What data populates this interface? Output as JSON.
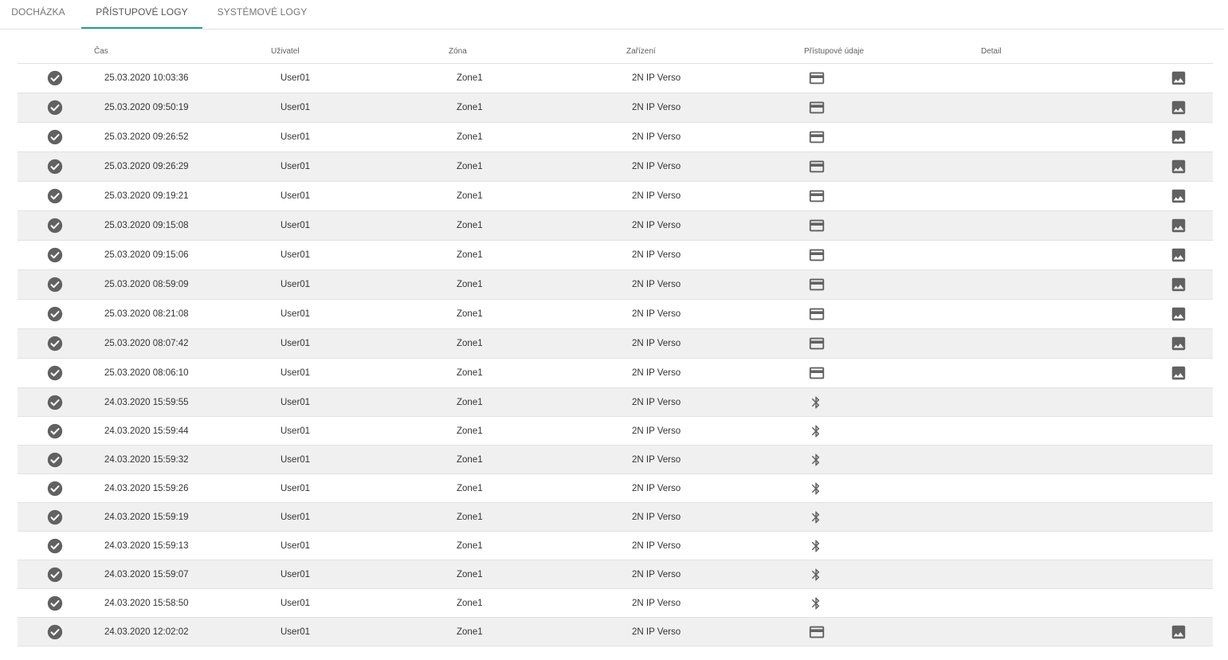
{
  "tabs": [
    {
      "label": "DOCHÁZKA"
    },
    {
      "label": "PŘÍSTUPOVÉ LOGY"
    },
    {
      "label": "SYSTÉMOVÉ LOGY"
    }
  ],
  "active_tab": "PŘÍSTUPOVÉ LOGY",
  "accent_color": "#27a18d",
  "table": {
    "headers": {
      "time": "Čas",
      "user": "Uživatel",
      "zone": "Zóna",
      "device": "Zařízení",
      "credentials": "Přístupové údaje",
      "detail": "Detail"
    },
    "rows": [
      {
        "time": "25.03.2020 10:03:36",
        "user": "User01",
        "zone": "Zone1",
        "device": "2N IP Verso",
        "credential_icon": "card-icon",
        "has_photo": true
      },
      {
        "time": "25.03.2020 09:50:19",
        "user": "User01",
        "zone": "Zone1",
        "device": "2N IP Verso",
        "credential_icon": "card-icon",
        "has_photo": true
      },
      {
        "time": "25.03.2020 09:26:52",
        "user": "User01",
        "zone": "Zone1",
        "device": "2N IP Verso",
        "credential_icon": "card-icon",
        "has_photo": true
      },
      {
        "time": "25.03.2020 09:26:29",
        "user": "User01",
        "zone": "Zone1",
        "device": "2N IP Verso",
        "credential_icon": "card-icon",
        "has_photo": true
      },
      {
        "time": "25.03.2020 09:19:21",
        "user": "User01",
        "zone": "Zone1",
        "device": "2N IP Verso",
        "credential_icon": "card-icon",
        "has_photo": true
      },
      {
        "time": "25.03.2020 09:15:08",
        "user": "User01",
        "zone": "Zone1",
        "device": "2N IP Verso",
        "credential_icon": "card-icon",
        "has_photo": true
      },
      {
        "time": "25.03.2020 09:15:06",
        "user": "User01",
        "zone": "Zone1",
        "device": "2N IP Verso",
        "credential_icon": "card-icon",
        "has_photo": true
      },
      {
        "time": "25.03.2020 08:59:09",
        "user": "User01",
        "zone": "Zone1",
        "device": "2N IP Verso",
        "credential_icon": "card-icon",
        "has_photo": true
      },
      {
        "time": "25.03.2020 08:21:08",
        "user": "User01",
        "zone": "Zone1",
        "device": "2N IP Verso",
        "credential_icon": "card-icon",
        "has_photo": true
      },
      {
        "time": "25.03.2020 08:07:42",
        "user": "User01",
        "zone": "Zone1",
        "device": "2N IP Verso",
        "credential_icon": "card-icon",
        "has_photo": true
      },
      {
        "time": "25.03.2020 08:06:10",
        "user": "User01",
        "zone": "Zone1",
        "device": "2N IP Verso",
        "credential_icon": "card-icon",
        "has_photo": true
      },
      {
        "time": "24.03.2020 15:59:55",
        "user": "User01",
        "zone": "Zone1",
        "device": "2N IP Verso",
        "credential_icon": "bluetooth-icon",
        "has_photo": false
      },
      {
        "time": "24.03.2020 15:59:44",
        "user": "User01",
        "zone": "Zone1",
        "device": "2N IP Verso",
        "credential_icon": "bluetooth-icon",
        "has_photo": false
      },
      {
        "time": "24.03.2020 15:59:32",
        "user": "User01",
        "zone": "Zone1",
        "device": "2N IP Verso",
        "credential_icon": "bluetooth-icon",
        "has_photo": false
      },
      {
        "time": "24.03.2020 15:59:26",
        "user": "User01",
        "zone": "Zone1",
        "device": "2N IP Verso",
        "credential_icon": "bluetooth-icon",
        "has_photo": false
      },
      {
        "time": "24.03.2020 15:59:19",
        "user": "User01",
        "zone": "Zone1",
        "device": "2N IP Verso",
        "credential_icon": "bluetooth-icon",
        "has_photo": false
      },
      {
        "time": "24.03.2020 15:59:13",
        "user": "User01",
        "zone": "Zone1",
        "device": "2N IP Verso",
        "credential_icon": "bluetooth-icon",
        "has_photo": false
      },
      {
        "time": "24.03.2020 15:59:07",
        "user": "User01",
        "zone": "Zone1",
        "device": "2N IP Verso",
        "credential_icon": "bluetooth-icon",
        "has_photo": false
      },
      {
        "time": "24.03.2020 15:58:50",
        "user": "User01",
        "zone": "Zone1",
        "device": "2N IP Verso",
        "credential_icon": "bluetooth-icon",
        "has_photo": false
      },
      {
        "time": "24.03.2020 12:02:02",
        "user": "User01",
        "zone": "Zone1",
        "device": "2N IP Verso",
        "credential_icon": "card-icon",
        "has_photo": true
      }
    ]
  }
}
